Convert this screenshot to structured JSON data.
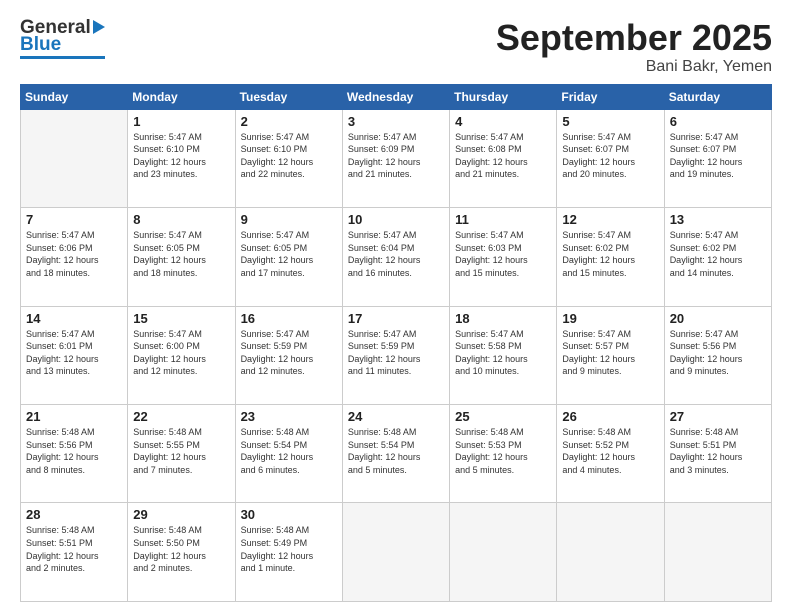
{
  "header": {
    "logo_general": "General",
    "logo_blue": "Blue",
    "title": "September 2025",
    "location": "Bani Bakr, Yemen"
  },
  "weekdays": [
    "Sunday",
    "Monday",
    "Tuesday",
    "Wednesday",
    "Thursday",
    "Friday",
    "Saturday"
  ],
  "weeks": [
    [
      {
        "day": "",
        "info": ""
      },
      {
        "day": "1",
        "info": "Sunrise: 5:47 AM\nSunset: 6:10 PM\nDaylight: 12 hours\nand 23 minutes."
      },
      {
        "day": "2",
        "info": "Sunrise: 5:47 AM\nSunset: 6:10 PM\nDaylight: 12 hours\nand 22 minutes."
      },
      {
        "day": "3",
        "info": "Sunrise: 5:47 AM\nSunset: 6:09 PM\nDaylight: 12 hours\nand 21 minutes."
      },
      {
        "day": "4",
        "info": "Sunrise: 5:47 AM\nSunset: 6:08 PM\nDaylight: 12 hours\nand 21 minutes."
      },
      {
        "day": "5",
        "info": "Sunrise: 5:47 AM\nSunset: 6:07 PM\nDaylight: 12 hours\nand 20 minutes."
      },
      {
        "day": "6",
        "info": "Sunrise: 5:47 AM\nSunset: 6:07 PM\nDaylight: 12 hours\nand 19 minutes."
      }
    ],
    [
      {
        "day": "7",
        "info": "Sunrise: 5:47 AM\nSunset: 6:06 PM\nDaylight: 12 hours\nand 18 minutes."
      },
      {
        "day": "8",
        "info": "Sunrise: 5:47 AM\nSunset: 6:05 PM\nDaylight: 12 hours\nand 18 minutes."
      },
      {
        "day": "9",
        "info": "Sunrise: 5:47 AM\nSunset: 6:05 PM\nDaylight: 12 hours\nand 17 minutes."
      },
      {
        "day": "10",
        "info": "Sunrise: 5:47 AM\nSunset: 6:04 PM\nDaylight: 12 hours\nand 16 minutes."
      },
      {
        "day": "11",
        "info": "Sunrise: 5:47 AM\nSunset: 6:03 PM\nDaylight: 12 hours\nand 15 minutes."
      },
      {
        "day": "12",
        "info": "Sunrise: 5:47 AM\nSunset: 6:02 PM\nDaylight: 12 hours\nand 15 minutes."
      },
      {
        "day": "13",
        "info": "Sunrise: 5:47 AM\nSunset: 6:02 PM\nDaylight: 12 hours\nand 14 minutes."
      }
    ],
    [
      {
        "day": "14",
        "info": "Sunrise: 5:47 AM\nSunset: 6:01 PM\nDaylight: 12 hours\nand 13 minutes."
      },
      {
        "day": "15",
        "info": "Sunrise: 5:47 AM\nSunset: 6:00 PM\nDaylight: 12 hours\nand 12 minutes."
      },
      {
        "day": "16",
        "info": "Sunrise: 5:47 AM\nSunset: 5:59 PM\nDaylight: 12 hours\nand 12 minutes."
      },
      {
        "day": "17",
        "info": "Sunrise: 5:47 AM\nSunset: 5:59 PM\nDaylight: 12 hours\nand 11 minutes."
      },
      {
        "day": "18",
        "info": "Sunrise: 5:47 AM\nSunset: 5:58 PM\nDaylight: 12 hours\nand 10 minutes."
      },
      {
        "day": "19",
        "info": "Sunrise: 5:47 AM\nSunset: 5:57 PM\nDaylight: 12 hours\nand 9 minutes."
      },
      {
        "day": "20",
        "info": "Sunrise: 5:47 AM\nSunset: 5:56 PM\nDaylight: 12 hours\nand 9 minutes."
      }
    ],
    [
      {
        "day": "21",
        "info": "Sunrise: 5:48 AM\nSunset: 5:56 PM\nDaylight: 12 hours\nand 8 minutes."
      },
      {
        "day": "22",
        "info": "Sunrise: 5:48 AM\nSunset: 5:55 PM\nDaylight: 12 hours\nand 7 minutes."
      },
      {
        "day": "23",
        "info": "Sunrise: 5:48 AM\nSunset: 5:54 PM\nDaylight: 12 hours\nand 6 minutes."
      },
      {
        "day": "24",
        "info": "Sunrise: 5:48 AM\nSunset: 5:54 PM\nDaylight: 12 hours\nand 5 minutes."
      },
      {
        "day": "25",
        "info": "Sunrise: 5:48 AM\nSunset: 5:53 PM\nDaylight: 12 hours\nand 5 minutes."
      },
      {
        "day": "26",
        "info": "Sunrise: 5:48 AM\nSunset: 5:52 PM\nDaylight: 12 hours\nand 4 minutes."
      },
      {
        "day": "27",
        "info": "Sunrise: 5:48 AM\nSunset: 5:51 PM\nDaylight: 12 hours\nand 3 minutes."
      }
    ],
    [
      {
        "day": "28",
        "info": "Sunrise: 5:48 AM\nSunset: 5:51 PM\nDaylight: 12 hours\nand 2 minutes."
      },
      {
        "day": "29",
        "info": "Sunrise: 5:48 AM\nSunset: 5:50 PM\nDaylight: 12 hours\nand 2 minutes."
      },
      {
        "day": "30",
        "info": "Sunrise: 5:48 AM\nSunset: 5:49 PM\nDaylight: 12 hours\nand 1 minute."
      },
      {
        "day": "",
        "info": ""
      },
      {
        "day": "",
        "info": ""
      },
      {
        "day": "",
        "info": ""
      },
      {
        "day": "",
        "info": ""
      }
    ]
  ]
}
